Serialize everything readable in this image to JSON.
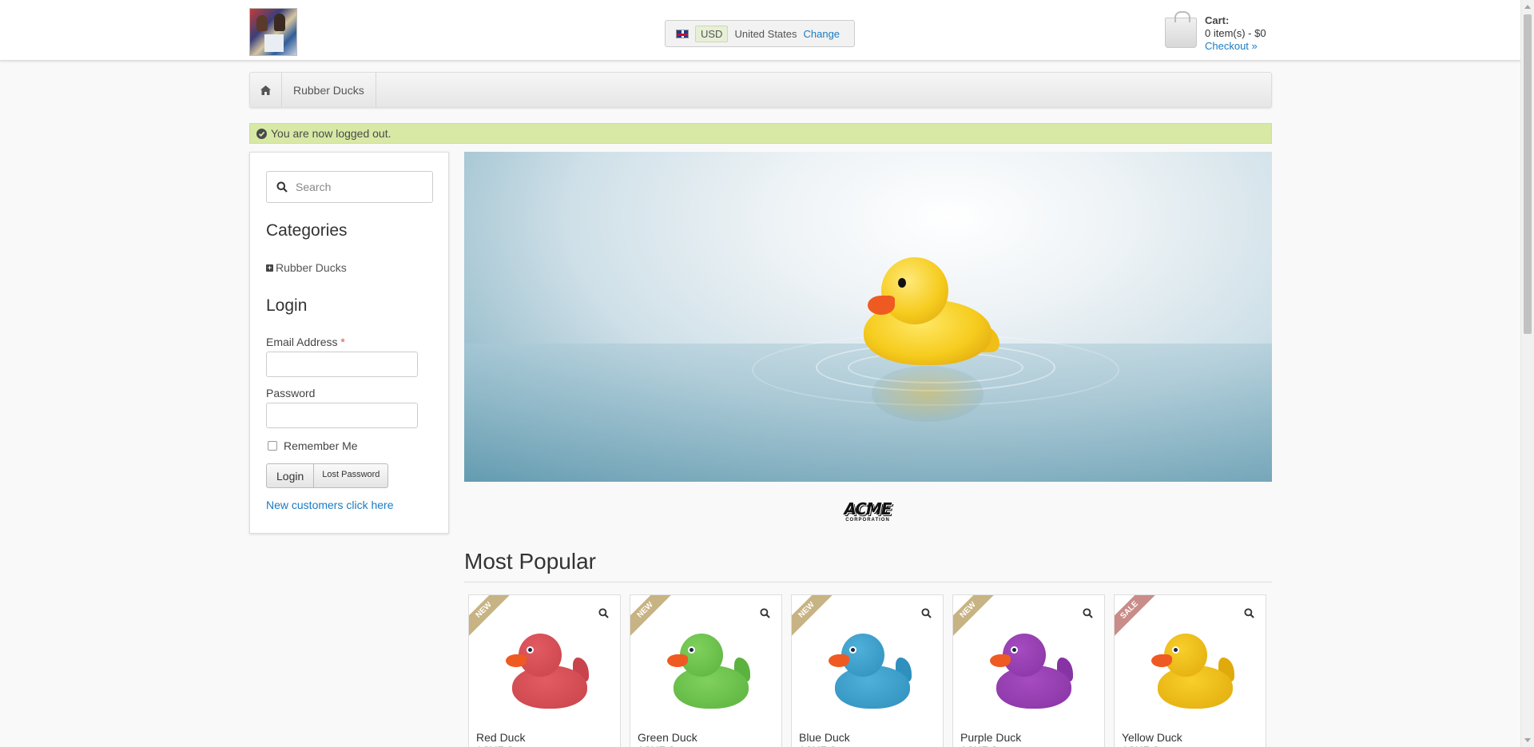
{
  "header": {
    "region": {
      "currency": "USD",
      "country": "United States",
      "change_label": "Change"
    },
    "cart": {
      "title": "Cart:",
      "summary": "0 item(s) - $0",
      "checkout_label": "Checkout »"
    }
  },
  "breadcrumb": {
    "items": [
      "Rubber Ducks"
    ]
  },
  "notice": {
    "text": "You are now logged out."
  },
  "sidebar": {
    "search": {
      "placeholder": "Search"
    },
    "categories": {
      "heading": "Categories",
      "items": [
        "Rubber Ducks"
      ]
    },
    "login": {
      "heading": "Login",
      "email_label": "Email Address",
      "required_mark": "*",
      "password_label": "Password",
      "remember_label": "Remember Me",
      "login_button": "Login",
      "lost_password_button": "Lost Password",
      "new_customers_link": "New customers click here"
    }
  },
  "brand": {
    "logo_text": "ACME",
    "logo_subtext": "CORPORATION"
  },
  "most_popular": {
    "heading": "Most Popular",
    "products": [
      {
        "name": "Red Duck",
        "manufacturer": "ACME Corp.",
        "badge": "NEW",
        "color": "#e35b62",
        "shade": "#c8434b"
      },
      {
        "name": "Green Duck",
        "manufacturer": "ACME Corp.",
        "badge": "NEW",
        "color": "#7fd15c",
        "shade": "#5bb23f"
      },
      {
        "name": "Blue Duck",
        "manufacturer": "ACME Corp.",
        "badge": "NEW",
        "color": "#4fb0d9",
        "shade": "#2f8fbd"
      },
      {
        "name": "Purple Duck",
        "manufacturer": "ACME Corp.",
        "badge": "NEW",
        "color": "#a54cc0",
        "shade": "#8733a3"
      },
      {
        "name": "Yellow Duck",
        "manufacturer": "ACME Corp.",
        "badge": "SALE",
        "color": "#f8cf2a",
        "shade": "#e0aa0c"
      }
    ]
  },
  "icons": {
    "home": "home-icon",
    "search": "search-icon",
    "check": "check-circle-icon",
    "category_expand": "plus-square-icon",
    "zoom": "magnifier-icon",
    "cart": "shopping-bag-icon",
    "flag": "uk-flag-icon"
  },
  "colors": {
    "link": "#1a7cc4",
    "notice_bg": "#d7e9a5",
    "badge_new": "#c7b383",
    "badge_sale": "#c98c88"
  }
}
